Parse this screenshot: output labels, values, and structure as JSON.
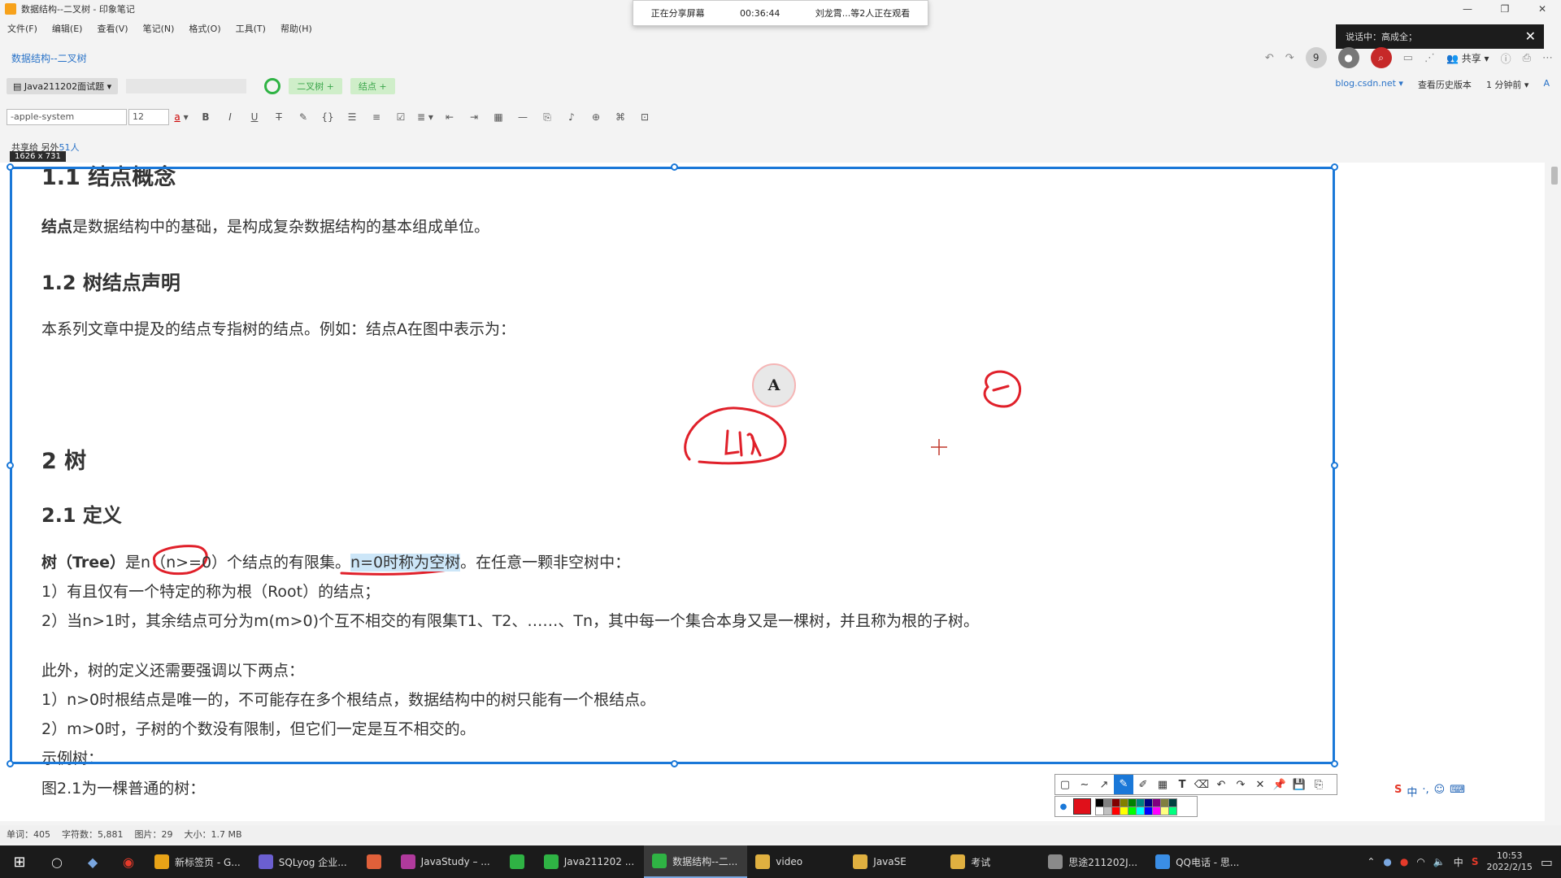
{
  "window": {
    "title": "数据结构--二叉树 - 印象笔记",
    "controls": [
      "—",
      "❐",
      "✕"
    ]
  },
  "share_banner": {
    "status": "正在分享屏幕",
    "time": "00:36:44",
    "viewers": "刘龙霄...等2人正在观看"
  },
  "speaking": {
    "text": "说话中：高成全；",
    "close": "✕"
  },
  "menu": [
    "文件(F)",
    "编辑(E)",
    "查看(V)",
    "笔记(N)",
    "格式(O)",
    "工具(T)",
    "帮助(H)"
  ],
  "notebook_path": "数据结构--二叉树",
  "header_right": {
    "count_badge": "9",
    "share_label": "共享"
  },
  "note_meta": {
    "notebook": "Java211202面试题",
    "tags": [
      "二叉树 +",
      "结点 +"
    ],
    "source_link": "blog.csdn.net",
    "history": "查看历史版本",
    "last_edited": "1 分钟前",
    "font_toggle": "A"
  },
  "format_toolbar": {
    "font": "-apple-system",
    "size": "12",
    "text_color_glyph": "a"
  },
  "shared_with": {
    "label": "共享给",
    "others_prefix": "另外",
    "count": "51人"
  },
  "capture_size": "1626 x 731",
  "content": {
    "h_1_1": "1.1 结点概念",
    "p_node_bold": "结点",
    "p_node_rest": "是数据结构中的基础，是构成复杂数据结构的基本组成单位。",
    "h_1_2": "1.2 树结点声明",
    "p_decl": "本系列文章中提及的结点专指树的结点。例如：结点A在图中表示为：",
    "node_label": "A",
    "h_2": "2 树",
    "h_2_1": "2.1 定义",
    "def_bold": "树（Tree）",
    "def_a": "是n（n>=0）个结点的有限集。",
    "def_hl": "n=0时称为空树",
    "def_b": "。在任意一颗非空树中：",
    "l1": "1）有且仅有一个特定的称为根（Root）的结点；",
    "l2": "2）当n>1时，其余结点可分为m(m>0)个互不相交的有限集T1、T2、……、Tn，其中每一个集合本身又是一棵树，并且称为根的子树。",
    "p_also": "此外，树的定义还需要强调以下两点：",
    "a1": "1）n>0时根结点是唯一的，不可能存在多个根结点，数据结构中的树只能有一个根结点。",
    "a2": "2）m>0时，子树的个数没有限制，但它们一定是互不相交的。",
    "example": "示例树：",
    "fig": "图2.1为一棵普通的树："
  },
  "status_bar": {
    "words": "单词：405",
    "chars": "字符数：5,881",
    "images": "图片：29",
    "size": "大小：1.7 MB"
  },
  "ime": [
    "中",
    "·,",
    "☺",
    "⌨"
  ],
  "taskbar": {
    "apps": [
      {
        "label": "新标签页 - G...",
        "color": "#e8a317"
      },
      {
        "label": "SQLyog 企业...",
        "color": "#6b5fd0"
      },
      {
        "label": "",
        "color": "#e0603a"
      },
      {
        "label": "JavaStudy – ...",
        "color": "#b03a9c"
      },
      {
        "label": "",
        "color": "#2fb344"
      },
      {
        "label": "Java211202 ...",
        "color": "#2fb344"
      },
      {
        "label": "数据结构--二...",
        "color": "#2fb344"
      },
      {
        "label": "video",
        "color": "#e0b040"
      },
      {
        "label": "JavaSE",
        "color": "#e0b040"
      },
      {
        "label": "考试",
        "color": "#e0b040"
      },
      {
        "label": "思途211202J...",
        "color": "#8a8a8a"
      },
      {
        "label": "QQ电话 - 思...",
        "color": "#3a8ee6"
      }
    ],
    "time": "10:53",
    "date": "2022/2/15",
    "ime_short": "中",
    "sogou": "S"
  },
  "palette_colors": [
    "#000000",
    "#808080",
    "#800000",
    "#808000",
    "#008000",
    "#008080",
    "#000080",
    "#800080",
    "#808040",
    "#004040",
    "#ffffff",
    "#c0c0c0",
    "#ff0000",
    "#ffff00",
    "#00ff00",
    "#00ffff",
    "#0000ff",
    "#ff00ff",
    "#ffff80",
    "#00ff80"
  ],
  "accent": "#1a78d8"
}
